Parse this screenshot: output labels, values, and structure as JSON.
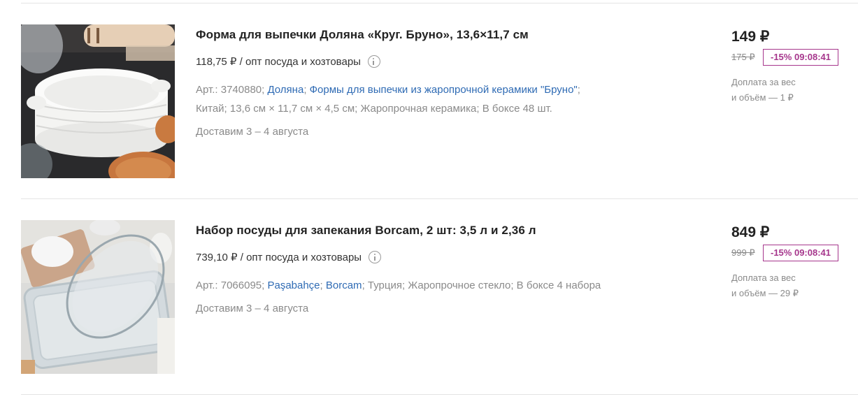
{
  "products": [
    {
      "title": "Форма для выпечки Доляна «Круг. Бруно», 13,6×11,7 см",
      "wholesale_price": "118,75 ₽ / опт посуда и хозтовары",
      "article": "Арт.: 3740880;",
      "brand_link": "Доляна",
      "category_link": "Формы для выпечки из жаропрочной керамики \"Бруно\"",
      "attrs_rest": "Китай;  13,6 см × 11,7 см × 4,5 см;  Жаропрочная керамика;  В боксе 48 шт.",
      "delivery": "Доставим 3 – 4 августа",
      "price": "149 ₽",
      "old_price": "175 ₽",
      "discount": "-15% 09:08:41",
      "extra_fee_line1": "Доплата за вес",
      "extra_fee_line2": "и объём — 1 ₽"
    },
    {
      "title": "Набор посуды для запекания Borcam, 2 шт: 3,5 л и 2,36 л",
      "wholesale_price": "739,10 ₽ / опт посуда и хозтовары",
      "article": "Арт.: 7066095;",
      "brand_link": "Paşabahçe",
      "category_link": "Borcam",
      "attrs_rest": "Турция;  Жаропрочное стекло;  В боксе 4 набора",
      "delivery": "Доставим 3 – 4 августа",
      "price": "849 ₽",
      "old_price": "999 ₽",
      "discount": "-15% 09:08:41",
      "extra_fee_line1": "Доплата за вес",
      "extra_fee_line2": "и объём — 29 ₽"
    }
  ],
  "icons": {
    "info": "info-circle-icon"
  },
  "colors": {
    "link": "#2f6bb4",
    "discount": "#a6368c",
    "muted": "#8a8a8a"
  }
}
